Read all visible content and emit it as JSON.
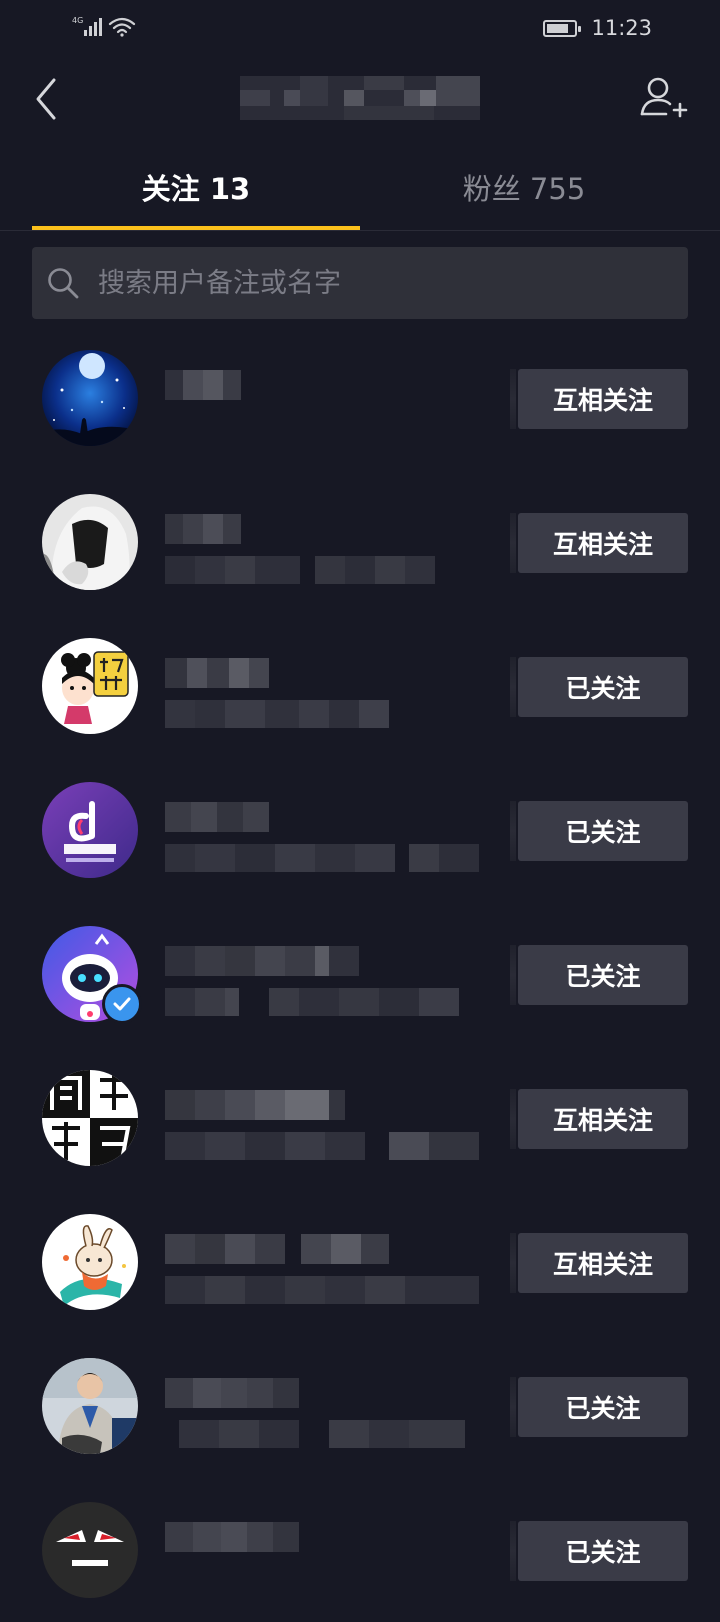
{
  "status_bar": {
    "network": "4G",
    "time": "11:23",
    "battery_level": 0.8
  },
  "nav": {
    "title": ""
  },
  "tabs": [
    {
      "label": "关注 13",
      "active": true
    },
    {
      "label": "粉丝 755",
      "active": false
    }
  ],
  "search": {
    "placeholder": "搜索用户备注或名字",
    "value": ""
  },
  "users": [
    {
      "avatar": "starry-sky-avatar",
      "verified": false,
      "button": "互相关注"
    },
    {
      "avatar": "hooded-figure-avatar",
      "verified": false,
      "button": "互相关注"
    },
    {
      "avatar": "haowu-cartoon-avatar",
      "verified": false,
      "button": "已关注"
    },
    {
      "avatar": "shaking-tech-logo-avatar",
      "verified": false,
      "button": "已关注"
    },
    {
      "avatar": "robot-mascot-avatar",
      "verified": true,
      "button": "已关注"
    },
    {
      "avatar": "zhichang-jiqiao-logo-avatar",
      "verified": false,
      "button": "互相关注"
    },
    {
      "avatar": "rabbit-cartoon-avatar",
      "verified": false,
      "button": "互相关注"
    },
    {
      "avatar": "man-in-suit-avatar",
      "verified": false,
      "button": "已关注"
    },
    {
      "avatar": "black-mask-avatar",
      "verified": false,
      "button": "已关注"
    }
  ],
  "colors": {
    "background": "#171824",
    "tab_indicator": "#fcc11c",
    "button_bg": "#3a3b47",
    "search_bg": "#2f3039",
    "verified_badge": "#3a95ee"
  }
}
